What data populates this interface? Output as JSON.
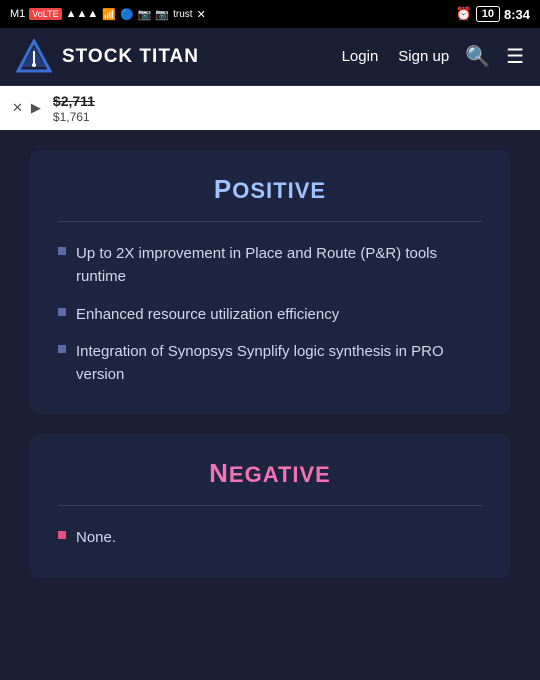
{
  "statusBar": {
    "left": "M1 VoLTE 4G ▲ wifi bt cam insta trust X",
    "alarm": "⏰",
    "battery": "10",
    "time": "8:34"
  },
  "navbar": {
    "logoText": "STOCK TITAN",
    "loginLabel": "Login",
    "signupLabel": "Sign up"
  },
  "adBanner": {
    "price1": "$2,711",
    "price2": "$1,761"
  },
  "positive": {
    "title": "Positive",
    "firstLetter": "P",
    "rest": "ositive",
    "bullets": [
      "Up to 2X improvement in Place and Route (P&R) tools runtime",
      "Enhanced resource utilization efficiency",
      "Integration of Synopsys Synplify logic synthesis in PRO version"
    ]
  },
  "negative": {
    "title": "Negative",
    "firstLetter": "N",
    "rest": "egative",
    "bullets": [
      "None."
    ]
  }
}
